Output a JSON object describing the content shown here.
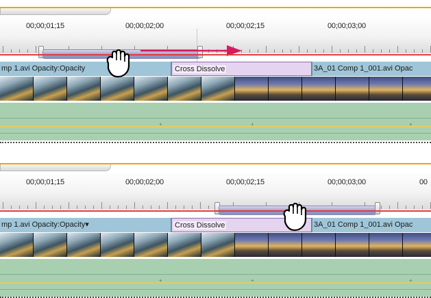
{
  "panels": [
    {
      "id": "before",
      "timecodes": [
        "00;00;01;15",
        "00;00;02;00",
        "00;00;02;15",
        "00;00;03;00"
      ],
      "clip_left_label": "mp 1.avi  Opacity:Opacity",
      "transition_label": "Cross Dissolve",
      "clip_right_label": "3A_01 Comp 1_001.avi  Opac"
    },
    {
      "id": "after",
      "timecodes": [
        "00;00;01;15",
        "00;00;02;00",
        "00;00;02;15",
        "00;00;03;00",
        "00"
      ],
      "clip_left_label": "mp 1.avi  Opacity:Opacity▾",
      "transition_label": "Cross Dissolve",
      "clip_right_label": "3A_01 Comp 1_001.avi  Opac"
    }
  ],
  "colors": {
    "accent_top": "#f0a400",
    "drag_arrow": "#d81b60",
    "cti_red": "#e03c3c",
    "video_clip": "#9fc5d8",
    "transition": "#e4d4ef",
    "audio_track": "#a8d0b0"
  },
  "icons": {
    "drag_cursor": "hand-grab-icon",
    "drag_arrow": "arrow-right-icon"
  }
}
